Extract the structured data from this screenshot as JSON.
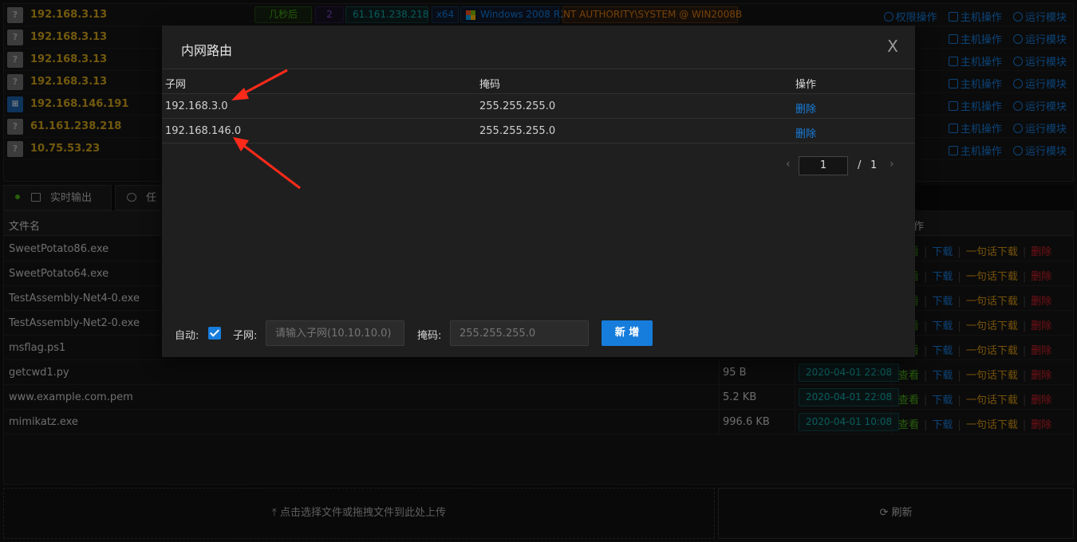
{
  "hosts": [
    {
      "ip": "192.168.3.13",
      "os": "?",
      "tags": {
        "time": "几秒后",
        "count": "2",
        "pubip": "61.161.238.218",
        "arch": "x64",
        "os": "Windows 2008 R2",
        "user": "NT AUTHORITY\\SYSTEM @ WIN2008B"
      }
    },
    {
      "ip": "192.168.3.13",
      "os": "?"
    },
    {
      "ip": "192.168.3.13",
      "os": "?"
    },
    {
      "ip": "192.168.3.13",
      "os": "?"
    },
    {
      "ip": "192.168.146.191",
      "os": "win"
    },
    {
      "ip": "61.161.238.218",
      "os": "?"
    },
    {
      "ip": "10.75.53.23",
      "os": "?"
    }
  ],
  "host_ops": {
    "privilege": "权限操作",
    "host": "主机操作",
    "module": "运行模块"
  },
  "tabs": {
    "live_output": "实时输出",
    "task_partial": "任"
  },
  "files": {
    "header_name": "文件名",
    "header_ops_partial": "作",
    "rows": [
      {
        "name": "SweetPotato86.exe",
        "size": "",
        "date": ""
      },
      {
        "name": "SweetPotato64.exe",
        "size": "",
        "date": ""
      },
      {
        "name": "TestAssembly-Net4-0.exe",
        "size": "",
        "date": ""
      },
      {
        "name": "TestAssembly-Net2-0.exe",
        "size": "",
        "date": ""
      },
      {
        "name": "msflag.ps1",
        "size": "",
        "date": ""
      },
      {
        "name": "getcwd1.py",
        "size": "95 B",
        "date": "2020-04-01 22:08"
      },
      {
        "name": "www.example.com.pem",
        "size": "5.2 KB",
        "date": "2020-04-01 22:08"
      },
      {
        "name": "mimikatz.exe",
        "size": "996.6 KB",
        "date": "2020-04-01 10:08"
      }
    ],
    "actions": {
      "view": "查看",
      "download": "下载",
      "oneliner": "一句话下载",
      "delete": "删除"
    }
  },
  "upload_label": "点击选择文件或拖拽文件到此处上传",
  "refresh_label": "刷新",
  "modal": {
    "title": "内网路由",
    "close": "X",
    "columns": {
      "subnet": "子网",
      "mask": "掩码",
      "action": "操作"
    },
    "routes": [
      {
        "subnet": "192.168.3.0",
        "mask": "255.255.255.0",
        "action": "删除"
      },
      {
        "subnet": "192.168.146.0",
        "mask": "255.255.255.0",
        "action": "删除"
      }
    ],
    "pagination": {
      "current": "1",
      "separator": "/",
      "total": "1"
    },
    "form": {
      "auto_label": "自动:",
      "auto_checked": true,
      "subnet_label": "子网:",
      "subnet_placeholder": "请输入子网(10.10.10.0)",
      "mask_label": "掩码:",
      "mask_placeholder": "255.255.255.0",
      "add_button": "新 增"
    }
  },
  "colors": {
    "accent": "#177ddc",
    "host_ip": "#d0a21a",
    "annotation_arrow": "#ff2a1a"
  }
}
